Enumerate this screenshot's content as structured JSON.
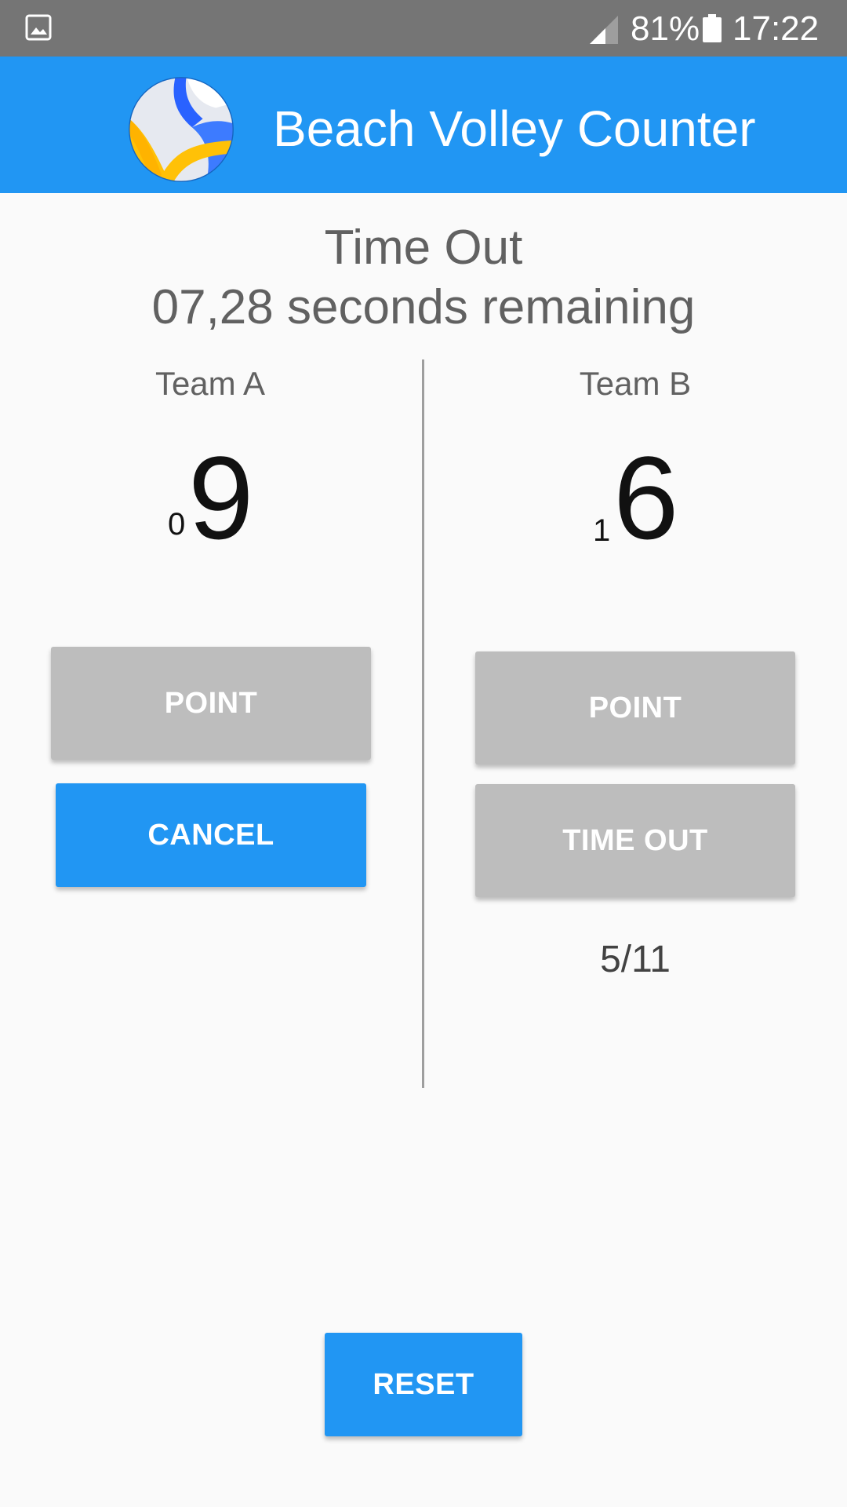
{
  "status_bar": {
    "battery_percent": "81%",
    "time": "17:22",
    "icons": [
      "gallery-icon",
      "signal-icon",
      "battery-icon"
    ]
  },
  "app_bar": {
    "title": "Beach Volley Counter",
    "logo_icon": "volleyball-logo-icon"
  },
  "timeout": {
    "title": "Time Out",
    "remaining": "07,28 seconds remaining"
  },
  "team_a": {
    "name": "Team A",
    "sets": "0",
    "score": "9",
    "point_label": "POINT",
    "cancel_label": "CANCEL"
  },
  "team_b": {
    "name": "Team B",
    "sets": "1",
    "score": "6",
    "point_label": "POINT",
    "timeout_label": "TIME OUT",
    "timeout_count": "5/11"
  },
  "reset_label": "RESET",
  "colors": {
    "primary": "#2196f3",
    "status_bar": "#757575",
    "button_disabled": "#bdbdbd",
    "background": "#fafafa"
  }
}
